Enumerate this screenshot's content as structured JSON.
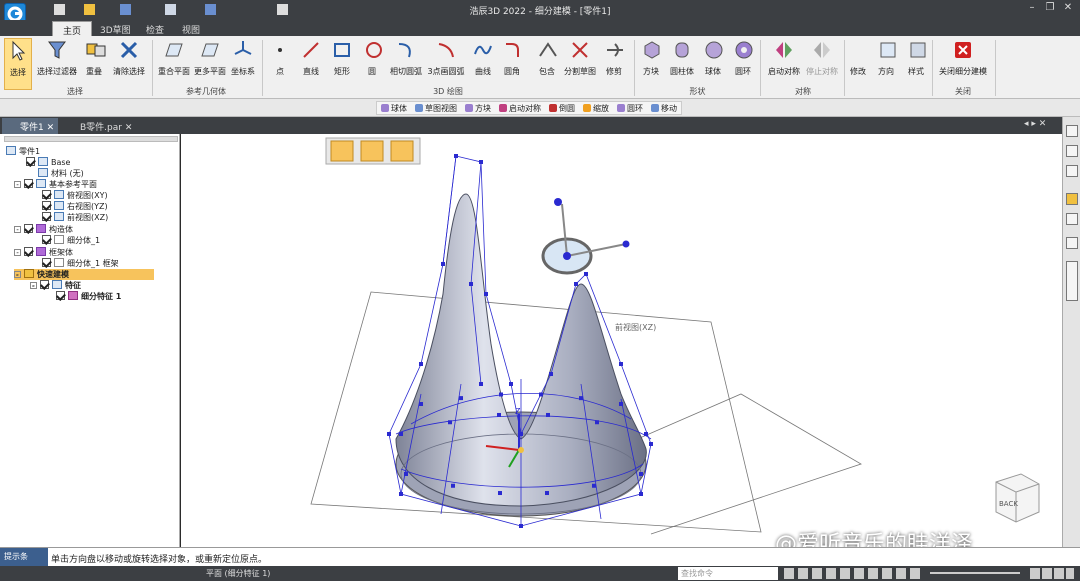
{
  "app": {
    "title": "浩辰3D 2022 - 细分建模 - [零件1]"
  },
  "tabs": [
    "主页",
    "3D草图",
    "检查",
    "视图"
  ],
  "ribbon": {
    "buttons": [
      "选择",
      "选择过滤器",
      "重叠",
      "清除选择",
      "重合平面",
      "更多平面",
      "坐标系",
      "点",
      "直线",
      "矩形",
      "圆",
      "相切圆弧",
      "3点画圆弧",
      "曲线",
      "圆角",
      "包含",
      "分割草图",
      "修剪",
      "方块",
      "圆柱体",
      "球体",
      "圆环",
      "启动对称",
      "停止对称",
      "修改",
      "方向",
      "样式",
      "关闭细分建模"
    ],
    "groups": [
      "选择",
      "参考几何体",
      "3D 绘图",
      "形状",
      "对称",
      "关闭"
    ]
  },
  "command_bar": [
    "球体",
    "草图视图",
    "方块",
    "启动对称",
    "倒圆",
    "缩放",
    "圆环",
    "移动"
  ],
  "doc_tabs": [
    "零件1",
    "B零件.par"
  ],
  "tree": {
    "root": "零件1",
    "items": [
      {
        "label": "Base"
      },
      {
        "label": "材料 (无)"
      },
      {
        "label": "基本参考平面"
      },
      {
        "label": "俯视图(XY)"
      },
      {
        "label": "右视图(YZ)"
      },
      {
        "label": "前视图(XZ)"
      },
      {
        "label": "构造体"
      },
      {
        "label": "细分体_1"
      },
      {
        "label": "框架体"
      },
      {
        "label": "细分体_1 框架"
      },
      {
        "label": "快速建模"
      },
      {
        "label": "特征"
      },
      {
        "label": "细分特征 1"
      }
    ]
  },
  "viewport": {
    "plane_label": "前视图(XZ)",
    "view_cube_label": "BACK",
    "axis_z": "Z"
  },
  "prompt": {
    "label": "提示条",
    "text": "单击方向盘以移动或旋转选择对象，或重新定位原点。"
  },
  "status": {
    "text": "平面 (细分特征 1)",
    "search_placeholder": "查找命令"
  },
  "watermark": "@爱听音乐的眭洋泽",
  "colors": {
    "accent": "#1e88d8",
    "cage": "#2a2ad0",
    "surface": "#b8bccb",
    "highlight": "#f7c35c"
  }
}
